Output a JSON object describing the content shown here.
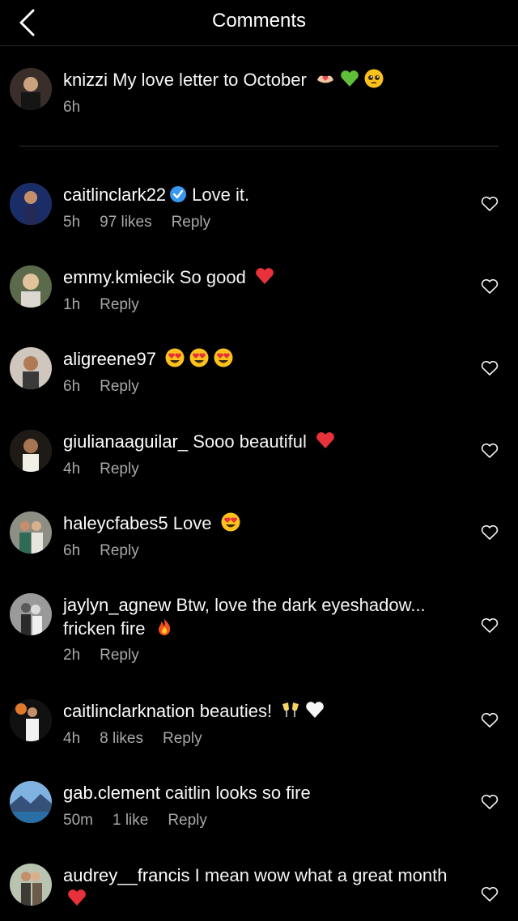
{
  "header": {
    "title": "Comments"
  },
  "caption": {
    "username": "knizzi",
    "text": "My love letter to October",
    "emojis": [
      "hands-heart",
      "green-heart",
      "pleading-face"
    ],
    "time": "6h"
  },
  "comments": [
    {
      "username": "caitlinclark22",
      "verified": true,
      "text": "Love it.",
      "emojis": [],
      "time": "5h",
      "likes": "97 likes",
      "reply": "Reply"
    },
    {
      "username": "emmy.kmiecik",
      "text": "So good",
      "emojis": [
        "red-heart"
      ],
      "time": "1h",
      "likes": "",
      "reply": "Reply"
    },
    {
      "username": "aligreene97",
      "text": "",
      "emojis": [
        "heart-eyes",
        "heart-eyes",
        "heart-eyes"
      ],
      "time": "6h",
      "likes": "",
      "reply": "Reply"
    },
    {
      "username": "giulianaaguilar_",
      "text": "Sooo beautiful",
      "emojis": [
        "red-heart"
      ],
      "time": "4h",
      "likes": "",
      "reply": "Reply"
    },
    {
      "username": "haleycfabes5",
      "text": "Love",
      "emojis": [
        "heart-eyes"
      ],
      "time": "6h",
      "likes": "",
      "reply": "Reply"
    },
    {
      "username": "jaylyn_agnew",
      "text": "Btw, love the dark eyeshadow... fricken fire",
      "emojis": [
        "fire"
      ],
      "time": "2h",
      "likes": "",
      "reply": "Reply"
    },
    {
      "username": "caitlinclarknation",
      "text": "beauties!",
      "emojis": [
        "clinking-glasses",
        "white-heart"
      ],
      "time": "4h",
      "likes": "8 likes",
      "reply": "Reply"
    },
    {
      "username": "gab.clement",
      "text": "caitlin looks so fire",
      "emojis": [],
      "time": "50m",
      "likes": "1 like",
      "reply": "Reply"
    },
    {
      "username": "audrey__francis",
      "text": "I mean wow what a great month",
      "emojis": [
        "red-heart"
      ],
      "time": "",
      "likes": "",
      "reply": ""
    }
  ],
  "colors": {
    "background": "#000000",
    "text": "#f5f5f5",
    "meta": "#a8a8a8",
    "verified": "#3897f0",
    "heart": "#ed4956"
  }
}
